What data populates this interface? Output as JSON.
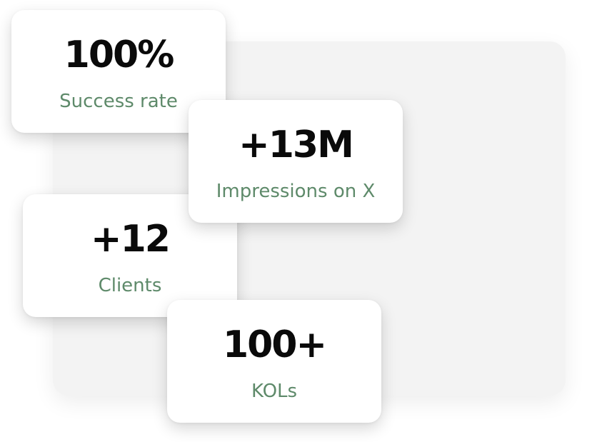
{
  "stats": [
    {
      "value": "100%",
      "label": "Success rate"
    },
    {
      "value": "+13M",
      "label": "Impressions on X"
    },
    {
      "value": "+12",
      "label": "Clients"
    },
    {
      "value": "100+",
      "label": "KOLs"
    }
  ],
  "colors": {
    "label": "#5e8a6a",
    "value": "#0a0a0a",
    "card": "#ffffff",
    "backdrop": "#f3f3f3"
  }
}
